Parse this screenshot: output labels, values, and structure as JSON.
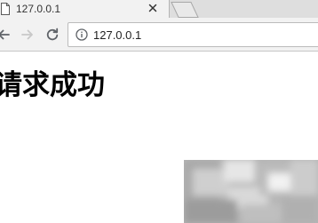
{
  "tab": {
    "title": "127.0.0.1"
  },
  "address_bar": {
    "url": "127.0.0.1"
  },
  "page": {
    "heading": "请求成功"
  }
}
